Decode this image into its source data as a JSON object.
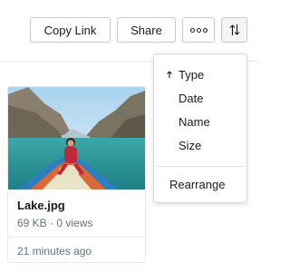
{
  "toolbar": {
    "copy_link_label": "Copy Link",
    "share_label": "Share",
    "more_icon": "more-options-icon",
    "sort_icon": "sort-arrows-icon"
  },
  "sort_menu": {
    "items": [
      {
        "label": "Type",
        "active": true,
        "icon": "arrow-up-icon"
      },
      {
        "label": "Date"
      },
      {
        "label": "Name"
      },
      {
        "label": "Size"
      }
    ],
    "rearrange_label": "Rearrange"
  },
  "file": {
    "name": "Lake.jpg",
    "meta": "69 KB · 0 views",
    "time": "21 minutes ago",
    "thumbnail": "lake-photo"
  },
  "colors": {
    "text": "#1e1919",
    "muted": "#637282",
    "border": "#c4c8cd",
    "divider": "#e6e8eb"
  }
}
